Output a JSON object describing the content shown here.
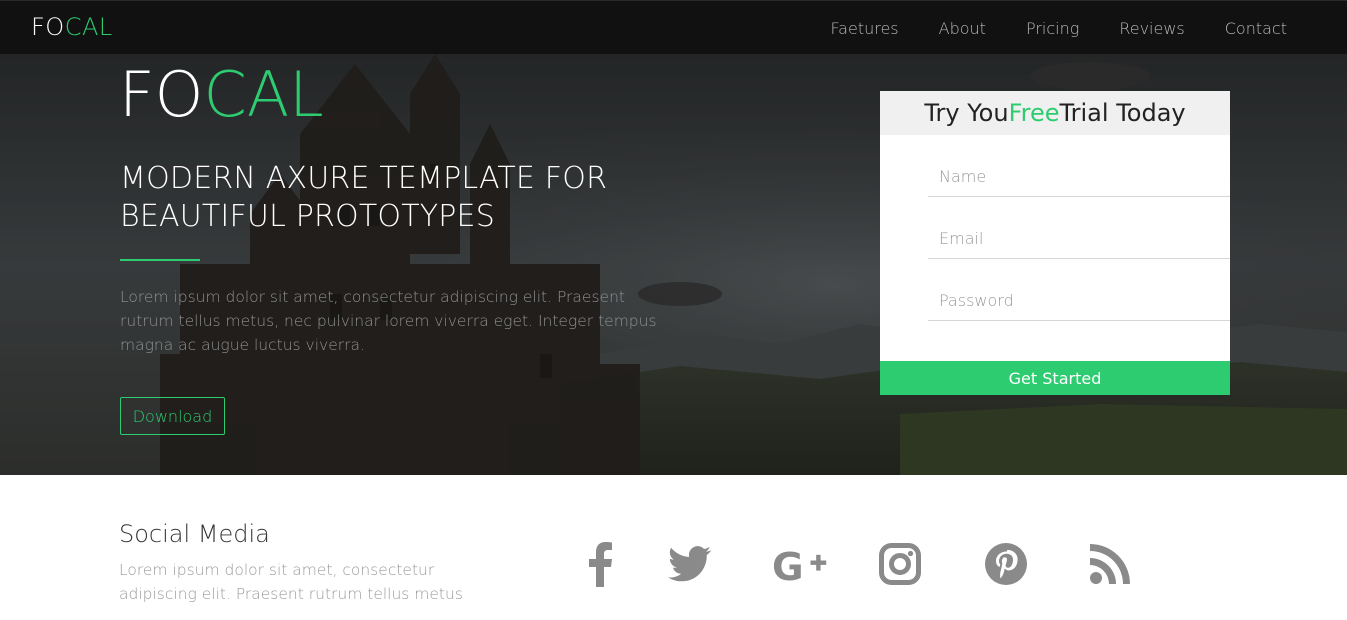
{
  "nav": {
    "logo_fo": "FO",
    "logo_cal": "CAL",
    "links": [
      "Faetures",
      "About",
      "Pricing",
      "Reviews",
      "Contact"
    ]
  },
  "hero": {
    "logo_fo": "FO",
    "logo_cal": "CAL",
    "headline": "MODERN AXURE TEMPLATE FOR BEAUTIFUL PROTOTYPES",
    "body": "Lorem ipsum dolor sit amet, consectetur adipiscing elit. Praesent rutrum tellus metus, nec pulvinar lorem viverra eget. Integer tempus magna ac augue luctus viverra.",
    "download_label": "Download"
  },
  "trial": {
    "title_pre": "Try You ",
    "title_free": "Free",
    "title_post": " Trial Today",
    "name_placeholder": "Name",
    "email_placeholder": "Email",
    "password_placeholder": "Password",
    "button_label": "Get Started"
  },
  "social": {
    "title": "Social Media",
    "text": "Lorem ipsum dolor sit amet, consectetur adipiscing elit. Praesent rutrum tellus metus",
    "icons": [
      "facebook-icon",
      "twitter-icon",
      "google-plus-icon",
      "instagram-icon",
      "pinterest-icon",
      "rss-icon"
    ]
  },
  "colors": {
    "accent": "#2ecc71",
    "navbar": "#111111",
    "icon_gray": "#8a8a8a"
  }
}
